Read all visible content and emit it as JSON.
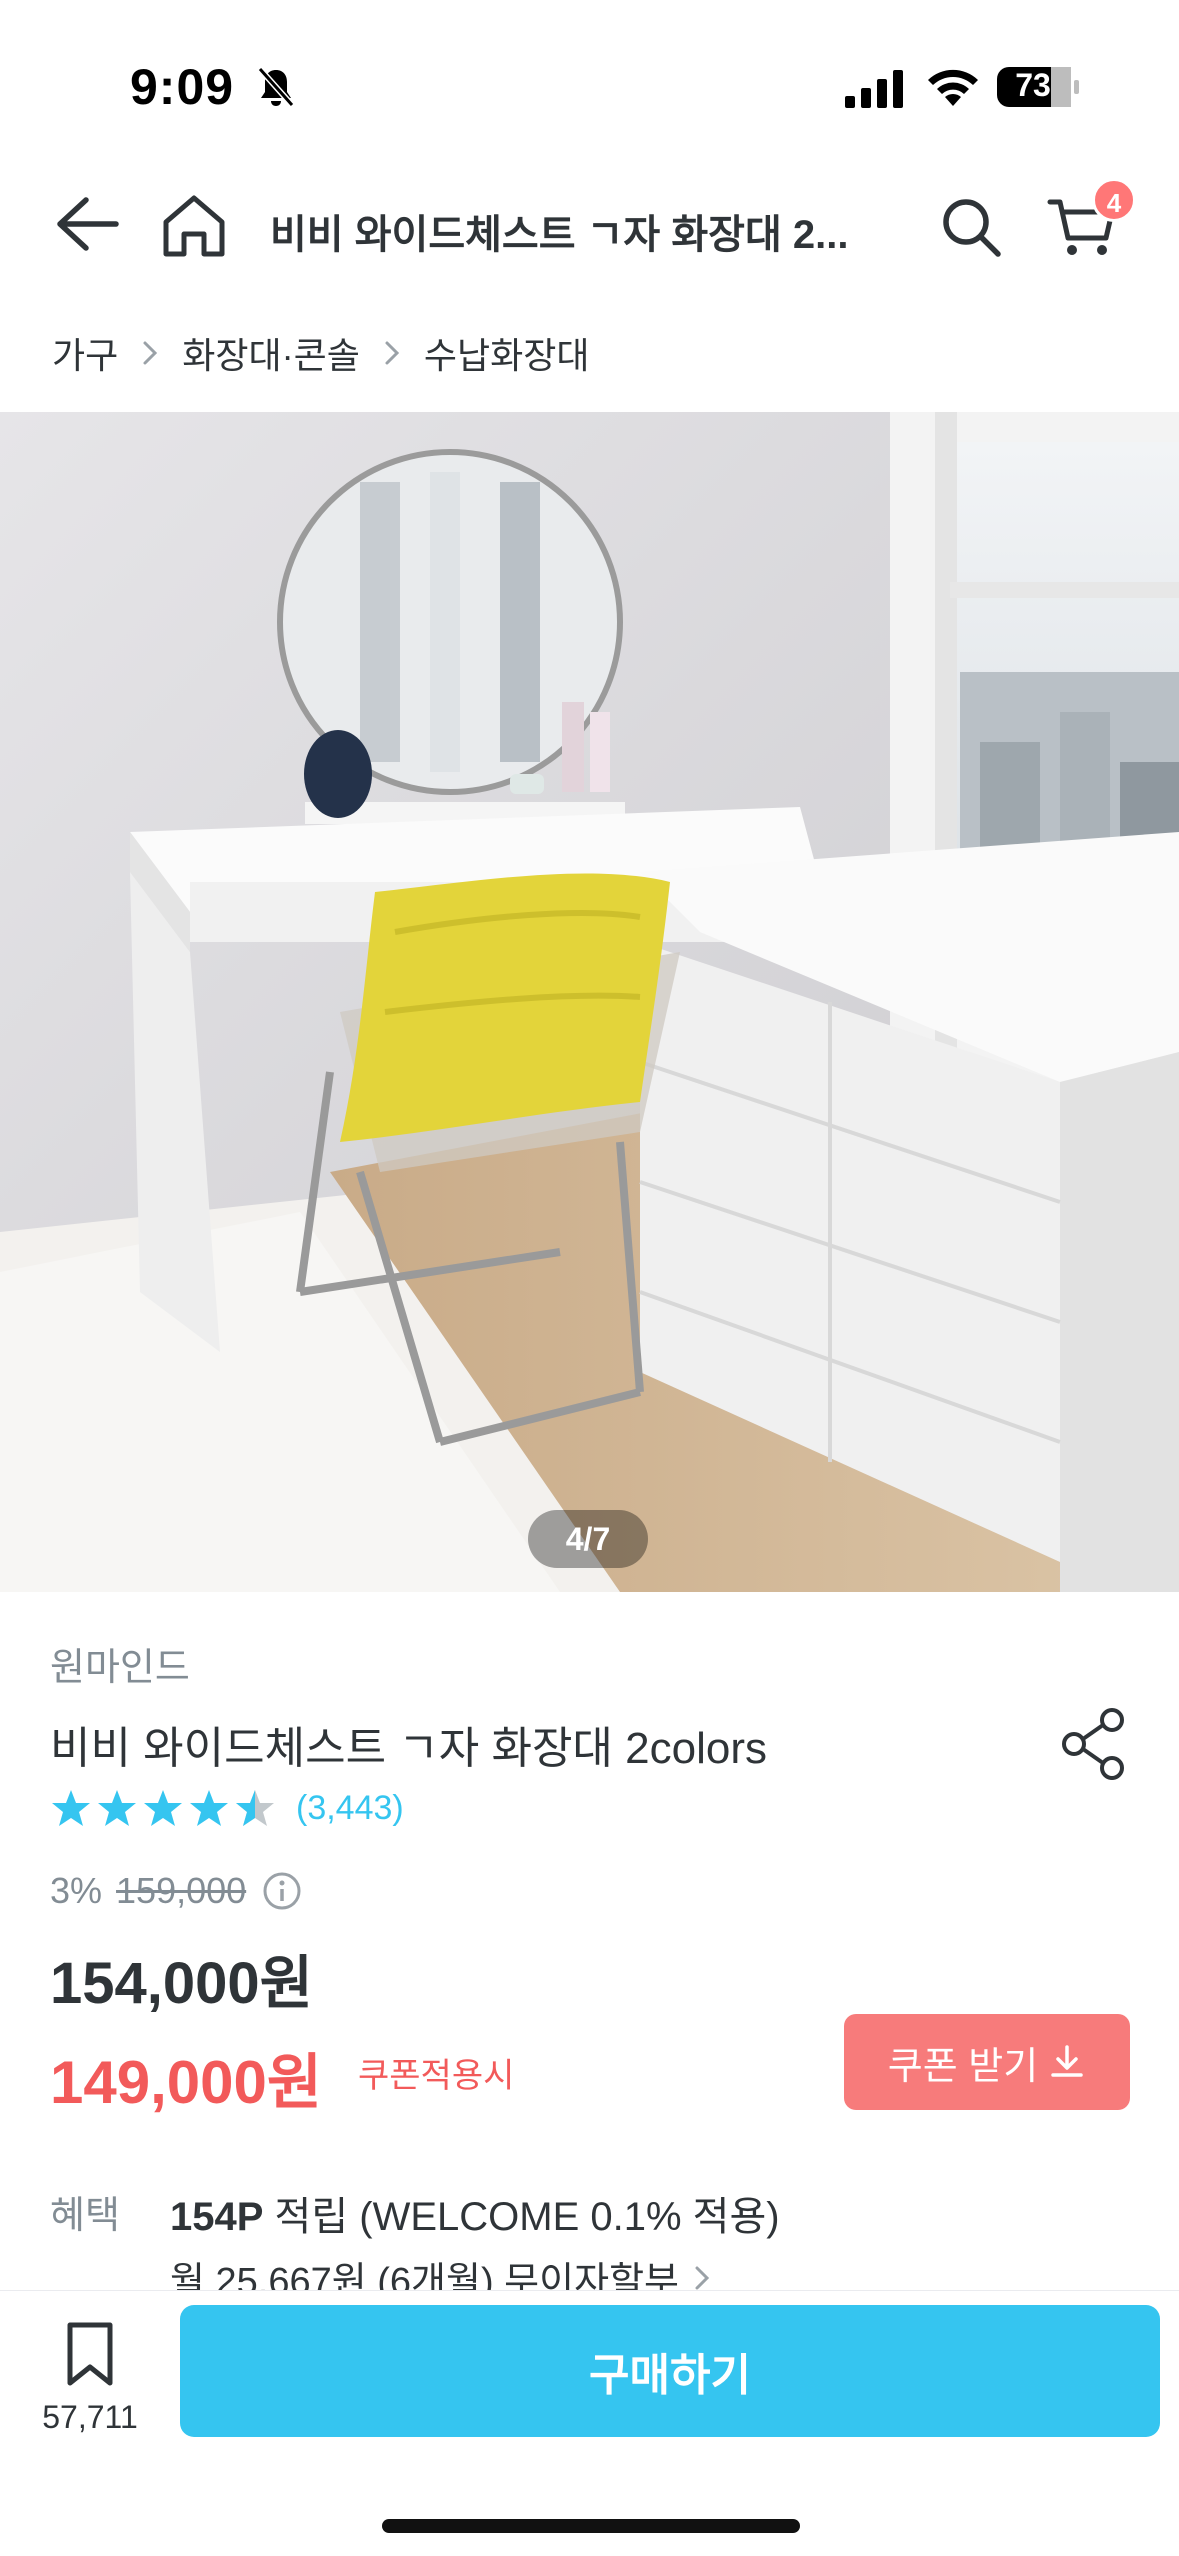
{
  "status_bar": {
    "time": "9:09",
    "battery": "73"
  },
  "header": {
    "title": "비비 와이드체스트 ㄱ자 화장대 2...",
    "cart_count": "4"
  },
  "breadcrumb": [
    "가구",
    "화장대·콘솔",
    "수납화장대"
  ],
  "gallery": {
    "counter": "4/7"
  },
  "product": {
    "brand": "원마인드",
    "name": "비비 와이드체스트 ㄱ자 화장대 2colors",
    "rating": 4.5,
    "review_count": "(3,443)",
    "discount_rate": "3%",
    "original_price": "159,000",
    "sale_price": "154,000원",
    "coupon_price": "149,000원",
    "coupon_note": "쿠폰적용시",
    "coupon_button": "쿠폰 받기"
  },
  "benefit": {
    "label": "혜택",
    "point_bold": "154P",
    "point_rest": " 적립 (WELCOME 0.1% 적용)",
    "installment": "월 25,667원 (6개월) 무이자할부"
  },
  "bottom_bar": {
    "bookmark_count": "57,711",
    "buy_label": "구매하기"
  },
  "colors": {
    "accent": "#35c5f0",
    "coupon": "#f25a5a",
    "coupon_button": "#f77b7b",
    "muted": "#828c94"
  }
}
